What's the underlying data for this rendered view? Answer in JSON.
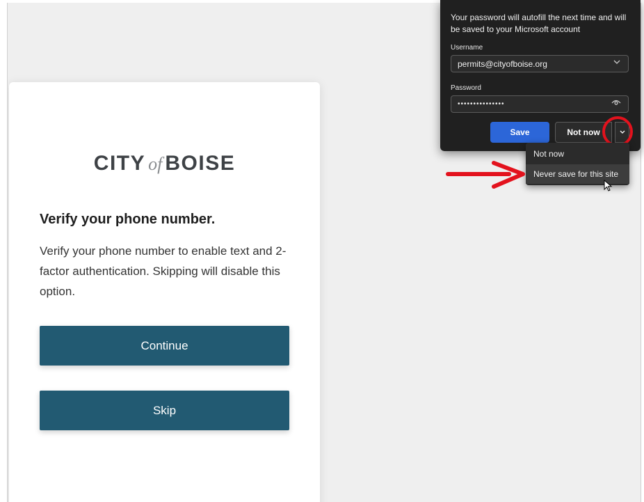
{
  "card": {
    "logo": {
      "word1": "CITY",
      "word2": "of",
      "word3": "BOISE"
    },
    "title": "Verify your phone number.",
    "description": "Verify your phone number to enable text and 2-factor authentication. Skipping will disable this option.",
    "continue_label": "Continue",
    "skip_label": "Skip"
  },
  "password_popup": {
    "message": "Your password will autofill the next time and will be saved to your Microsoft account",
    "username_label": "Username",
    "username_value": "permits@cityofboise.org",
    "password_label": "Password",
    "password_value": "•••••••••••••••",
    "save_label": "Save",
    "not_now_label": "Not now",
    "menu_items": [
      "Not now",
      "Never save for this site"
    ]
  },
  "colors": {
    "brand_button": "#225a72",
    "save_button": "#2c66d8",
    "annotation": "#e3121d"
  },
  "icons": [
    "chevron-down-icon",
    "eye-icon",
    "mouse-cursor-icon",
    "red-arrow-annotation",
    "red-circle-annotation"
  ]
}
